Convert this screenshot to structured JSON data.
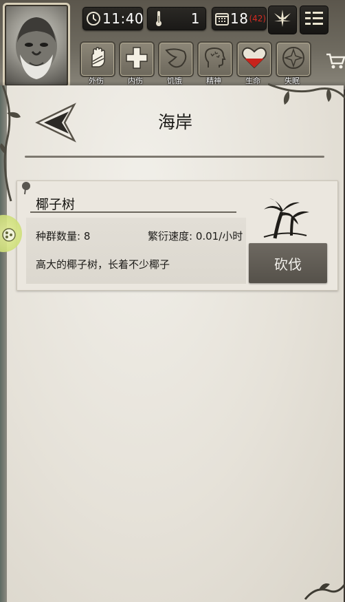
{
  "hud": {
    "time": "11:40",
    "temperature": "1",
    "day": "18",
    "day_sub": "(42)"
  },
  "status_icons": [
    {
      "label": "外伤",
      "icon": "hand-icon"
    },
    {
      "label": "内伤",
      "icon": "cross-icon"
    },
    {
      "label": "饥饿",
      "icon": "stomach-icon"
    },
    {
      "label": "精神",
      "icon": "head-icon"
    },
    {
      "label": "生命",
      "icon": "heart-icon"
    },
    {
      "label": "失眠",
      "icon": "moon-icon"
    }
  ],
  "page": {
    "title": "海岸"
  },
  "resource": {
    "name": "椰子树",
    "population_label": "种群数量: 8",
    "growth_label": "繁衍速度: 0.01/小时",
    "description": "高大的椰子树，长着不少椰子",
    "action_label": "砍伐",
    "icon": "palm-tree-icon"
  },
  "colors": {
    "paper": "#e8e4dc",
    "button_dark": "#5f5a53",
    "day_accent": "#d42a22",
    "health_red": "#c8231b"
  }
}
